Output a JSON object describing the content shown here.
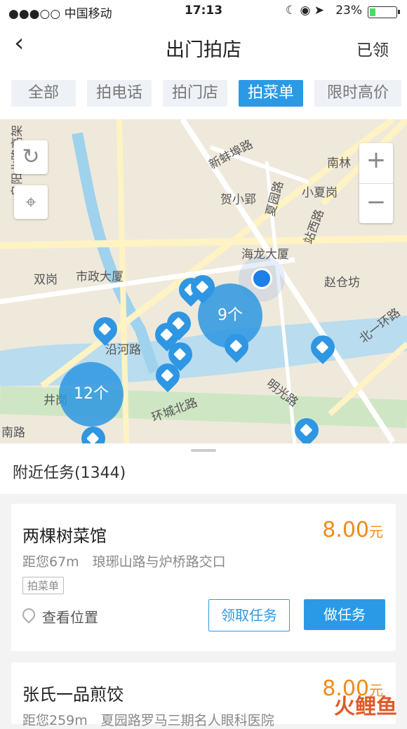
{
  "status": {
    "carrier": "●●●○○ 中国移动",
    "time": "17:13",
    "battery": "23%",
    "icons": "☾ ◉ ➤"
  },
  "nav": {
    "title": "出门拍店",
    "right": "已领",
    "back": "‹"
  },
  "tabs": [
    {
      "label": "全部"
    },
    {
      "label": "拍电话"
    },
    {
      "label": "拍门店"
    },
    {
      "label": "拍菜单",
      "active": true
    },
    {
      "label": "限时高价"
    }
  ],
  "map": {
    "labels": [
      "新蚌埠路",
      "贺小郢",
      "小夏岗",
      "南林",
      "海龙大厦",
      "市政大厦",
      "双岗",
      "赵仓坊",
      "北一环路",
      "明光路",
      "沿河路",
      "站西路",
      "阜阳北路高架",
      "夏园路",
      "环城北路",
      "井岗",
      "南路",
      "12个",
      "9个"
    ],
    "cluster_big": "9个",
    "cluster_left": "12个"
  },
  "list": {
    "title": "附近任务(1344)",
    "items": [
      {
        "name": "两棵树菜馆",
        "price": "8.00",
        "unit": "元",
        "distance": "距您67m　琅琊山路与炉桥路交口",
        "tag": "拍菜单",
        "loc": "查看位置",
        "claim": "领取任务",
        "do": "做任务"
      },
      {
        "name": "张氏一品煎饺",
        "price": "8.00",
        "unit": "元",
        "distance": "距您259m　夏园路罗马三期名人眼科医院"
      }
    ]
  },
  "watermark": "火鲤鱼"
}
